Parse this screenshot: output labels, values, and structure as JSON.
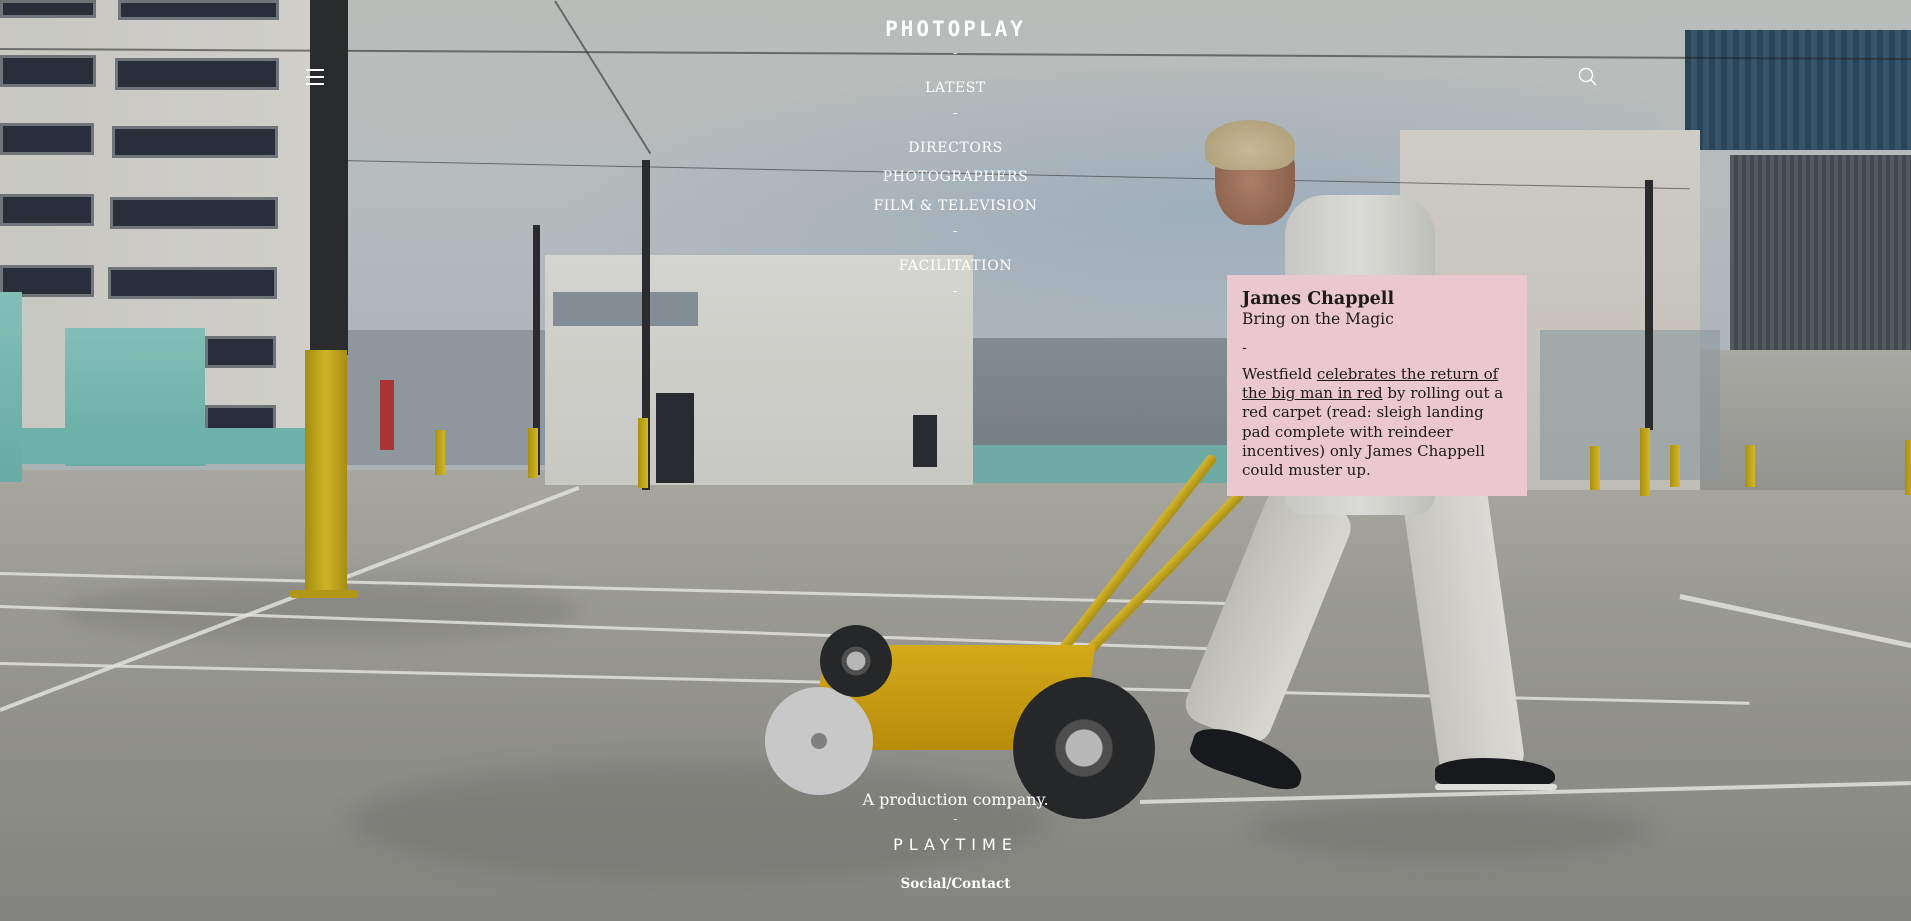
{
  "header": {
    "logo_text": "PHOTOPLAY"
  },
  "nav": {
    "separator": "-",
    "items": [
      {
        "label": "LATEST"
      },
      {
        "label": "DIRECTORS"
      },
      {
        "label": "PHOTOGRAPHERS"
      },
      {
        "label": "FILM & TELEVISION"
      },
      {
        "label": "FACILITATION"
      }
    ]
  },
  "icons": {
    "menu": "hamburger-menu-icon",
    "search": "search-icon"
  },
  "feature_card": {
    "name": "James Chappell",
    "title": "Bring on the Magic",
    "separator": "-",
    "body_prefix": "Westfield ",
    "body_link": "celebrates the return of the big man in red",
    "body_suffix": " by rolling out a red carpet (read: sleigh landing pad complete with reindeer incentives) only James Chappell could muster up.",
    "background_color": "#ebc8cf"
  },
  "footer": {
    "tagline": "A production company.",
    "separator": "-",
    "brand": "PLAYTIME",
    "social_contact": "Social/Contact"
  },
  "colors": {
    "text": "#ffffff",
    "card_bg": "#ebc8cf",
    "card_text": "#1c1a1a"
  }
}
